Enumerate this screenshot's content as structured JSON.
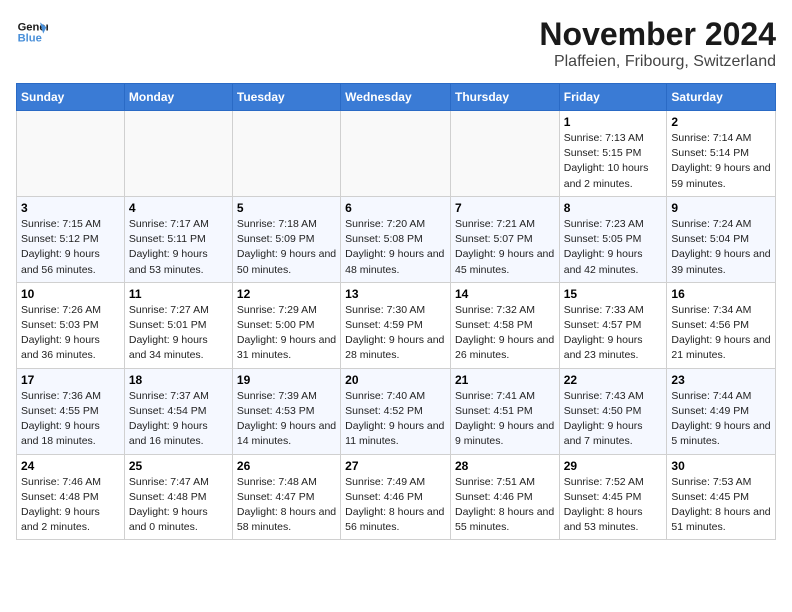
{
  "logo": {
    "line1": "General",
    "line2": "Blue"
  },
  "title": "November 2024",
  "location": "Plaffeien, Fribourg, Switzerland",
  "days_of_week": [
    "Sunday",
    "Monday",
    "Tuesday",
    "Wednesday",
    "Thursday",
    "Friday",
    "Saturday"
  ],
  "weeks": [
    [
      {
        "day": "",
        "info": ""
      },
      {
        "day": "",
        "info": ""
      },
      {
        "day": "",
        "info": ""
      },
      {
        "day": "",
        "info": ""
      },
      {
        "day": "",
        "info": ""
      },
      {
        "day": "1",
        "info": "Sunrise: 7:13 AM\nSunset: 5:15 PM\nDaylight: 10 hours and 2 minutes."
      },
      {
        "day": "2",
        "info": "Sunrise: 7:14 AM\nSunset: 5:14 PM\nDaylight: 9 hours and 59 minutes."
      }
    ],
    [
      {
        "day": "3",
        "info": "Sunrise: 7:15 AM\nSunset: 5:12 PM\nDaylight: 9 hours and 56 minutes."
      },
      {
        "day": "4",
        "info": "Sunrise: 7:17 AM\nSunset: 5:11 PM\nDaylight: 9 hours and 53 minutes."
      },
      {
        "day": "5",
        "info": "Sunrise: 7:18 AM\nSunset: 5:09 PM\nDaylight: 9 hours and 50 minutes."
      },
      {
        "day": "6",
        "info": "Sunrise: 7:20 AM\nSunset: 5:08 PM\nDaylight: 9 hours and 48 minutes."
      },
      {
        "day": "7",
        "info": "Sunrise: 7:21 AM\nSunset: 5:07 PM\nDaylight: 9 hours and 45 minutes."
      },
      {
        "day": "8",
        "info": "Sunrise: 7:23 AM\nSunset: 5:05 PM\nDaylight: 9 hours and 42 minutes."
      },
      {
        "day": "9",
        "info": "Sunrise: 7:24 AM\nSunset: 5:04 PM\nDaylight: 9 hours and 39 minutes."
      }
    ],
    [
      {
        "day": "10",
        "info": "Sunrise: 7:26 AM\nSunset: 5:03 PM\nDaylight: 9 hours and 36 minutes."
      },
      {
        "day": "11",
        "info": "Sunrise: 7:27 AM\nSunset: 5:01 PM\nDaylight: 9 hours and 34 minutes."
      },
      {
        "day": "12",
        "info": "Sunrise: 7:29 AM\nSunset: 5:00 PM\nDaylight: 9 hours and 31 minutes."
      },
      {
        "day": "13",
        "info": "Sunrise: 7:30 AM\nSunset: 4:59 PM\nDaylight: 9 hours and 28 minutes."
      },
      {
        "day": "14",
        "info": "Sunrise: 7:32 AM\nSunset: 4:58 PM\nDaylight: 9 hours and 26 minutes."
      },
      {
        "day": "15",
        "info": "Sunrise: 7:33 AM\nSunset: 4:57 PM\nDaylight: 9 hours and 23 minutes."
      },
      {
        "day": "16",
        "info": "Sunrise: 7:34 AM\nSunset: 4:56 PM\nDaylight: 9 hours and 21 minutes."
      }
    ],
    [
      {
        "day": "17",
        "info": "Sunrise: 7:36 AM\nSunset: 4:55 PM\nDaylight: 9 hours and 18 minutes."
      },
      {
        "day": "18",
        "info": "Sunrise: 7:37 AM\nSunset: 4:54 PM\nDaylight: 9 hours and 16 minutes."
      },
      {
        "day": "19",
        "info": "Sunrise: 7:39 AM\nSunset: 4:53 PM\nDaylight: 9 hours and 14 minutes."
      },
      {
        "day": "20",
        "info": "Sunrise: 7:40 AM\nSunset: 4:52 PM\nDaylight: 9 hours and 11 minutes."
      },
      {
        "day": "21",
        "info": "Sunrise: 7:41 AM\nSunset: 4:51 PM\nDaylight: 9 hours and 9 minutes."
      },
      {
        "day": "22",
        "info": "Sunrise: 7:43 AM\nSunset: 4:50 PM\nDaylight: 9 hours and 7 minutes."
      },
      {
        "day": "23",
        "info": "Sunrise: 7:44 AM\nSunset: 4:49 PM\nDaylight: 9 hours and 5 minutes."
      }
    ],
    [
      {
        "day": "24",
        "info": "Sunrise: 7:46 AM\nSunset: 4:48 PM\nDaylight: 9 hours and 2 minutes."
      },
      {
        "day": "25",
        "info": "Sunrise: 7:47 AM\nSunset: 4:48 PM\nDaylight: 9 hours and 0 minutes."
      },
      {
        "day": "26",
        "info": "Sunrise: 7:48 AM\nSunset: 4:47 PM\nDaylight: 8 hours and 58 minutes."
      },
      {
        "day": "27",
        "info": "Sunrise: 7:49 AM\nSunset: 4:46 PM\nDaylight: 8 hours and 56 minutes."
      },
      {
        "day": "28",
        "info": "Sunrise: 7:51 AM\nSunset: 4:46 PM\nDaylight: 8 hours and 55 minutes."
      },
      {
        "day": "29",
        "info": "Sunrise: 7:52 AM\nSunset: 4:45 PM\nDaylight: 8 hours and 53 minutes."
      },
      {
        "day": "30",
        "info": "Sunrise: 7:53 AM\nSunset: 4:45 PM\nDaylight: 8 hours and 51 minutes."
      }
    ]
  ]
}
